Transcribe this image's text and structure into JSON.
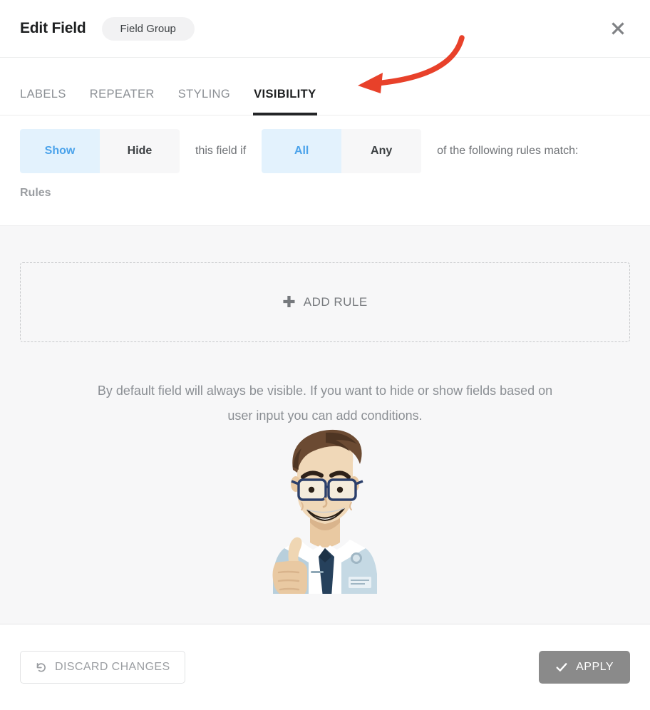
{
  "header": {
    "title": "Edit Field",
    "badge": "Field Group",
    "close_icon": "close-icon"
  },
  "tabs": [
    {
      "label": "LABELS",
      "active": false
    },
    {
      "label": "REPEATER",
      "active": false
    },
    {
      "label": "STYLING",
      "active": false
    },
    {
      "label": "VISIBILITY",
      "active": true
    }
  ],
  "annotation": {
    "type": "curved-arrow",
    "color": "#e8412a",
    "points_to": "VISIBILITY"
  },
  "condition": {
    "visibility_options": [
      {
        "label": "Show",
        "active": true
      },
      {
        "label": "Hide",
        "active": false
      }
    ],
    "middle_text": "this field if",
    "match_options": [
      {
        "label": "All",
        "active": true
      },
      {
        "label": "Any",
        "active": false
      }
    ],
    "trailing_text": "of the following rules match:",
    "active_bg": "#e3f2fd",
    "active_fg": "#4ba3eb",
    "inactive_bg": "#f7f7f8"
  },
  "rules": {
    "section_label": "Rules",
    "add_rule_label": "ADD RULE",
    "add_rule_icon": "plus-icon",
    "helper_text": "By default field will always be visible. If you want to hide or show fields based on user input you can add conditions.",
    "illustration": "man-with-glasses-thumbs-up-illustration"
  },
  "footer": {
    "discard_label": "DISCARD CHANGES",
    "discard_icon": "undo-icon",
    "apply_label": "APPLY",
    "apply_icon": "check-icon",
    "apply_bg": "#8a8a8a"
  }
}
